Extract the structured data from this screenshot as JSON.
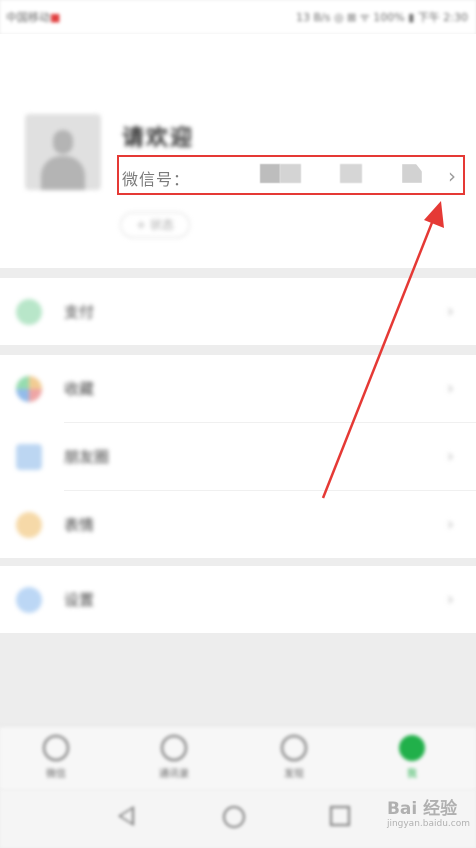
{
  "status_bar": {
    "carrier": "中国移动",
    "carrier_mark": "■",
    "right_text": "13 B/s ◎ ⊠ ᯤ 100% ▮ 下午 2:30"
  },
  "profile": {
    "nickname": "请欢迎",
    "wechat_id_label": "微信号：",
    "status_button": "+ 状态"
  },
  "menu_groups": [
    [
      {
        "label": "支付",
        "icon": "pay-icon",
        "color": "#3fbf6e"
      }
    ],
    [
      {
        "label": "收藏",
        "icon": "favorites-icon",
        "color": "#e7a23a"
      },
      {
        "label": "朋友圈",
        "icon": "moments-icon",
        "color": "#3a84d8"
      },
      {
        "label": "表情",
        "icon": "sticker-icon",
        "color": "#f2b33d"
      }
    ],
    [
      {
        "label": "设置",
        "icon": "settings-icon",
        "color": "#3f8fe6"
      }
    ]
  ],
  "tabbar": [
    {
      "label": "微信",
      "icon": "chat-icon"
    },
    {
      "label": "通讯录",
      "icon": "contacts-icon"
    },
    {
      "label": "发现",
      "icon": "discover-icon"
    },
    {
      "label": "我",
      "icon": "me-icon",
      "active": true
    }
  ],
  "watermark": {
    "text": "Bai 经验",
    "sub": "jingyan.baidu.com"
  },
  "annotation": {
    "color": "#e53935"
  }
}
